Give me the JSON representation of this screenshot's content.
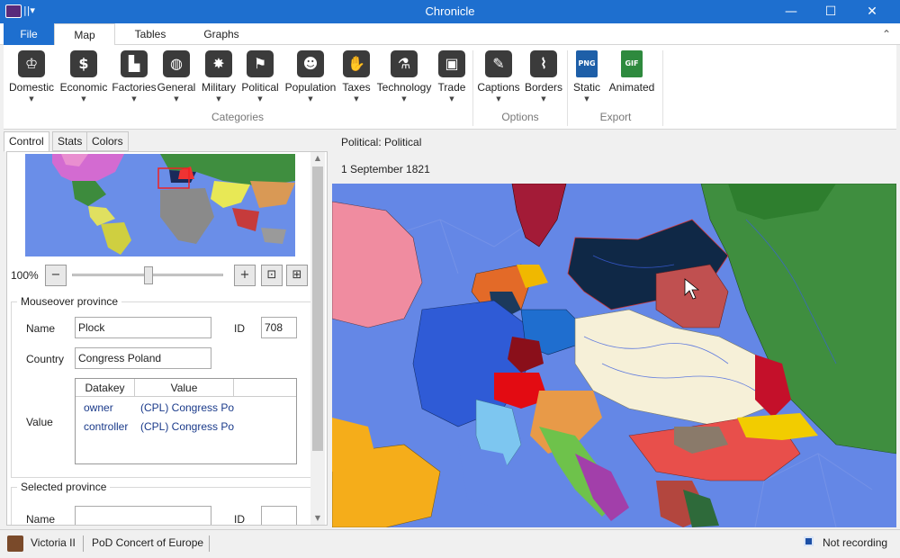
{
  "window": {
    "title": "Chronicle",
    "minimize": "—",
    "maximize": "☐",
    "close": "✕",
    "qa": "||▾"
  },
  "menu_tabs": {
    "file": "File",
    "map": "Map",
    "tables": "Tables",
    "graphs": "Graphs",
    "collapse": "⌃"
  },
  "ribbon": {
    "categories": [
      {
        "label": "Domestic",
        "icon": "crown-icon",
        "glyph": "♔",
        "color": "#3b3b3b"
      },
      {
        "label": "Economic",
        "icon": "money-bag-icon",
        "glyph": "$",
        "color": "#3b3b3b"
      },
      {
        "label": "Factories",
        "icon": "factory-icon",
        "glyph": "▙",
        "color": "#3b3b3b"
      },
      {
        "label": "General",
        "icon": "globe-icon",
        "glyph": "◍",
        "color": "#3b3b3b"
      },
      {
        "label": "Military",
        "icon": "cannon-icon",
        "glyph": "✸",
        "color": "#3b3b3b"
      },
      {
        "label": "Political",
        "icon": "flag-icon",
        "glyph": "⚑",
        "color": "#3b3b3b"
      },
      {
        "label": "Population",
        "icon": "people-icon",
        "glyph": "☻",
        "color": "#3b3b3b"
      },
      {
        "label": "Taxes",
        "icon": "taxes-hand-icon",
        "glyph": "✋",
        "color": "#3b3b3b"
      },
      {
        "label": "Technology",
        "icon": "microscope-icon",
        "glyph": "⚗",
        "color": "#3b3b3b"
      },
      {
        "label": "Trade",
        "icon": "crate-icon",
        "glyph": "▣",
        "color": "#3b3b3b"
      }
    ],
    "options": [
      {
        "label": "Captions",
        "icon": "map-pencil-icon",
        "glyph": "✎",
        "color": "#3b3b3b"
      },
      {
        "label": "Borders",
        "icon": "map-borders-icon",
        "glyph": "⌇",
        "color": "#3b3b3b"
      }
    ],
    "export": [
      {
        "label": "Static",
        "icon": "png-file-icon",
        "glyph": "PNG",
        "color": "#1e5fa8"
      },
      {
        "label": "Animated",
        "icon": "gif-file-icon",
        "glyph": "GIF",
        "color": "#2e8a3e"
      }
    ],
    "group_categories": "Categories",
    "group_options": "Options",
    "group_export": "Export",
    "dropdown": "▼"
  },
  "left_tabs": {
    "control": "Control",
    "stats": "Stats",
    "colors": "Colors"
  },
  "zoom": {
    "percent": "100%",
    "zoom_out": "−",
    "zoom_in": "+",
    "fit": "⊡",
    "reset": "⊞",
    "level": 0.5
  },
  "mouseover": {
    "group": "Mouseover province",
    "name_label": "Name",
    "name_value": "Plock",
    "id_label": "ID",
    "id_value": "708",
    "country_label": "Country",
    "country_value": "Congress Poland",
    "value_label": "Value",
    "grid": {
      "headers": [
        "Datakey",
        "Value"
      ],
      "rows": [
        {
          "key": "owner",
          "value": "(CPL) Congress Po"
        },
        {
          "key": "controller",
          "value": "(CPL) Congress Po"
        }
      ]
    }
  },
  "selected": {
    "group": "Selected province",
    "name_label": "Name",
    "id_label": "ID"
  },
  "scroll": {
    "up": "▲",
    "down": "▼"
  },
  "map_header": {
    "mode": "Political: Political",
    "date": "1 September 1821"
  },
  "status": {
    "game": "Victoria II",
    "mod": "PoD Concert of Europe",
    "recording": "Not recording"
  }
}
